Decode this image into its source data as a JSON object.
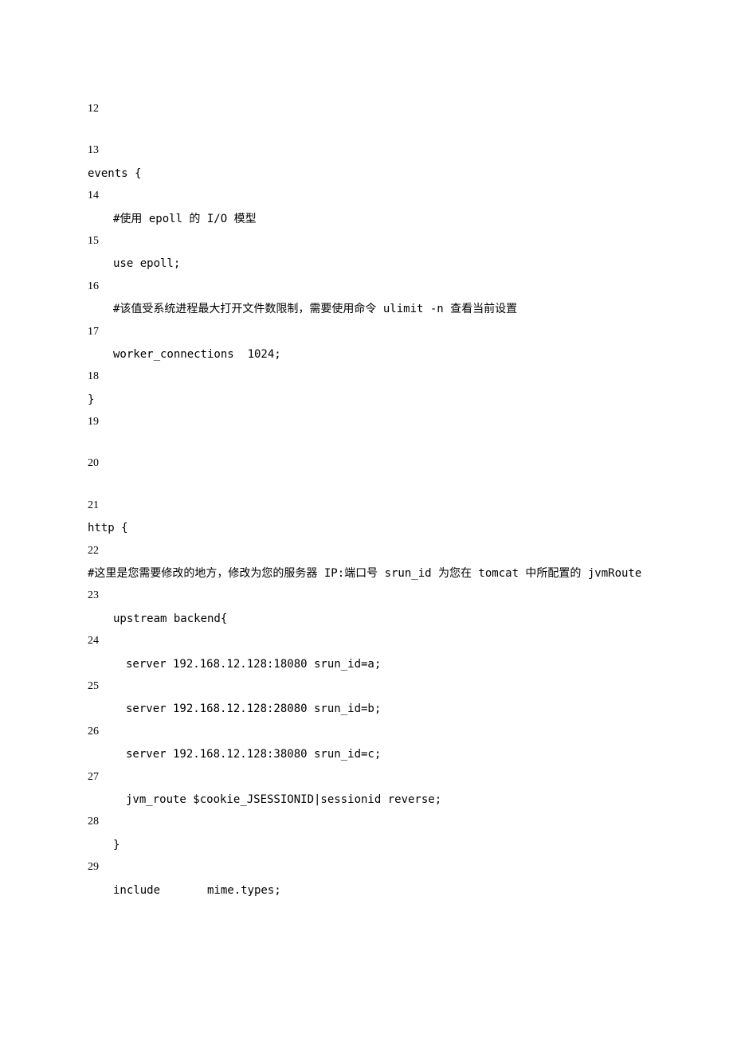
{
  "lines": {
    "n12": "12",
    "n13": "13",
    "l13": "events {",
    "n14": "14",
    "l14": "#使用 epoll 的 I/O 模型",
    "n15": "15",
    "l15": "use epoll;",
    "n16": "16",
    "l16": "#该值受系统进程最大打开文件数限制，需要使用命令 ulimit -n 查看当前设置",
    "n17": "17",
    "l17": "worker_connections  1024;",
    "n18": "18",
    "l18": "}",
    "n19": "19",
    "n20": "20",
    "n21": "21",
    "l21": "http {",
    "n22": "22",
    "l22a": "    #这里是您需要修改的地方，修改为您的服务器 IP:端口号 srun_id 为您在 tomcat 中所配置的 jvmRoute",
    "n23": "23",
    "l23": "upstream backend{",
    "n24": "24",
    "l24": "server 192.168.12.128:18080 srun_id=a;",
    "n25": "25",
    "l25": "server 192.168.12.128:28080 srun_id=b;",
    "n26": "26",
    "l26": "server 192.168.12.128:38080 srun_id=c;",
    "n27": "27",
    "l27": "jvm_route $cookie_JSESSIONID|sessionid reverse;",
    "n28": "28",
    "l28": "}",
    "n29": "29",
    "l29": "include       mime.types;"
  }
}
